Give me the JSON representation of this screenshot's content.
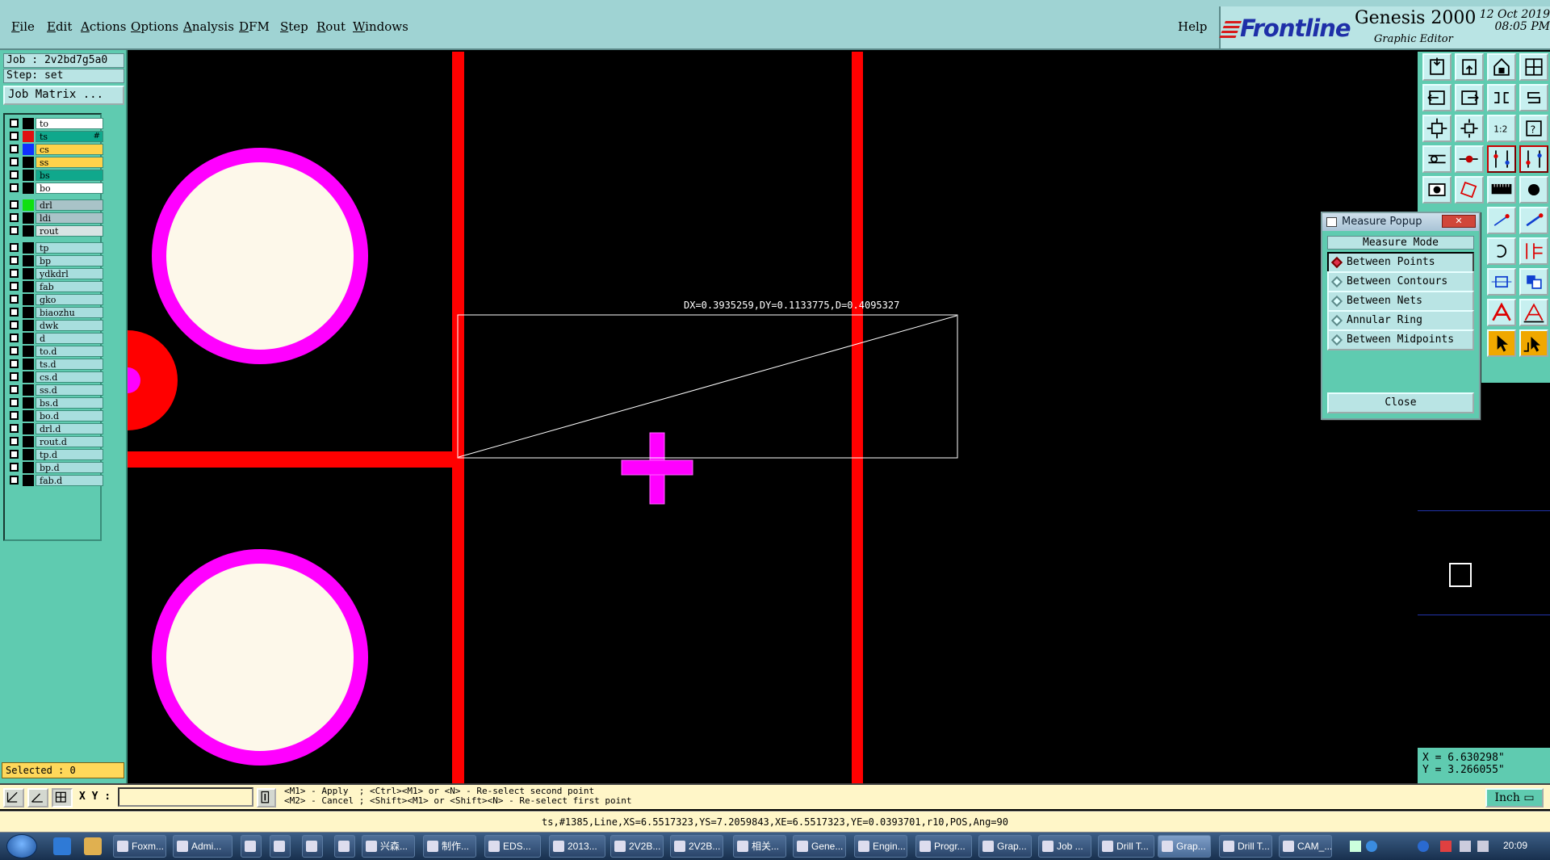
{
  "menu": {
    "items": [
      "File",
      "Edit",
      "Actions",
      "Options",
      "Analysis",
      "DFM",
      "Step",
      "Rout",
      "Windows"
    ],
    "help": "Help"
  },
  "brand": {
    "logo": "Frontline",
    "title": "Genesis 2000",
    "subtitle": "Graphic Editor",
    "date": "12 Oct 2019",
    "time": "08:05 PM"
  },
  "left": {
    "job": "Job : 2v2bd7g5a0",
    "step": "Step: set",
    "job_matrix": "Job Matrix ...",
    "selected": "Selected : 0"
  },
  "layers": [
    {
      "name": "to",
      "color": "#ffffff",
      "swatch": "#000000"
    },
    {
      "name": "ts",
      "color": "#10a88c",
      "swatch": "#e01010",
      "mark": "#"
    },
    {
      "name": "cs",
      "color": "#ffd24a",
      "swatch": "#1030ff"
    },
    {
      "name": "ss",
      "color": "#ffd24a",
      "swatch": "#000000"
    },
    {
      "name": "bs",
      "color": "#10a88c",
      "swatch": "#000000"
    },
    {
      "name": "bo",
      "color": "#ffffff",
      "swatch": "#000000"
    },
    {
      "name": "drl",
      "color": "#a9c3c8",
      "swatch": "#10e010"
    },
    {
      "name": "ldi",
      "color": "#a9c3c8",
      "swatch": "#000000"
    },
    {
      "name": "rout",
      "color": "#d8e4e4",
      "swatch": "#000000"
    },
    {
      "name": "tp",
      "color": "#a8dede",
      "swatch": "#000000"
    },
    {
      "name": "bp",
      "color": "#a8dede",
      "swatch": "#000000"
    },
    {
      "name": "ydkdrl",
      "color": "#a8dede",
      "swatch": "#000000"
    },
    {
      "name": "fab",
      "color": "#a8dede",
      "swatch": "#000000"
    },
    {
      "name": "gko",
      "color": "#a8dede",
      "swatch": "#000000"
    },
    {
      "name": "biaozhu",
      "color": "#a8dede",
      "swatch": "#000000"
    },
    {
      "name": "dwk",
      "color": "#a8dede",
      "swatch": "#000000"
    },
    {
      "name": "d",
      "color": "#a8dede",
      "swatch": "#000000"
    },
    {
      "name": "to.d",
      "color": "#a8dede",
      "swatch": "#000000"
    },
    {
      "name": "ts.d",
      "color": "#a8dede",
      "swatch": "#000000"
    },
    {
      "name": "cs.d",
      "color": "#a8dede",
      "swatch": "#000000"
    },
    {
      "name": "ss.d",
      "color": "#a8dede",
      "swatch": "#000000"
    },
    {
      "name": "bs.d",
      "color": "#a8dede",
      "swatch": "#000000"
    },
    {
      "name": "bo.d",
      "color": "#a8dede",
      "swatch": "#000000"
    },
    {
      "name": "drl.d",
      "color": "#a8dede",
      "swatch": "#000000"
    },
    {
      "name": "rout.d",
      "color": "#a8dede",
      "swatch": "#000000"
    },
    {
      "name": "tp.d",
      "color": "#a8dede",
      "swatch": "#000000"
    },
    {
      "name": "bp.d",
      "color": "#a8dede",
      "swatch": "#000000"
    },
    {
      "name": "fab.d",
      "color": "#a8dede",
      "swatch": "#000000"
    }
  ],
  "canvas": {
    "measure_readout": "DX=0.3935259,DY=0.1133775,D=0.4095327",
    "colors": {
      "trace": "#ff0000",
      "pad_ring": "#ff00ff",
      "pad_fill": "#fdf8ea",
      "measure": "#ffffff"
    }
  },
  "measure_popup": {
    "title": "Measure Popup",
    "close_x": "✕",
    "mode_label": "Measure Mode",
    "options": [
      {
        "label": "Between Points",
        "selected": true
      },
      {
        "label": "Between Contours",
        "selected": false
      },
      {
        "label": "Between Nets",
        "selected": false
      },
      {
        "label": "Annular Ring",
        "selected": false
      },
      {
        "label": "Between Midpoints",
        "selected": false
      }
    ],
    "close": "Close"
  },
  "coords": {
    "x": "X = 6.630298\"",
    "y": "Y = 3.266055\""
  },
  "command": {
    "xy_label": "X Y :",
    "xy_value": "",
    "help": "<M1> - Apply  ; <Ctrl><M1> or <N> - Re-select second point\n<M2> - Cancel ; <Shift><M1> or <Shift><N> - Re-select first point",
    "unit": "Inch"
  },
  "status": "ts,#1385,Line,XS=6.5517323,YS=7.2059843,XE=6.5517323,YE=0.0393701,r10,POS,Ang=90",
  "taskbar": {
    "tasks": [
      "Foxm...",
      "Admi...",
      "",
      "",
      "",
      "",
      "兴森...",
      "制作...",
      "EDS...",
      "2013...",
      "2V2B...",
      "2V2B...",
      "相关...",
      "Gene...",
      "Engin...",
      "Progr...",
      "Grap...",
      "Job ...",
      "Drill T...",
      "Grap...",
      "Drill T...",
      "CAM_..."
    ],
    "time": "20:09"
  }
}
